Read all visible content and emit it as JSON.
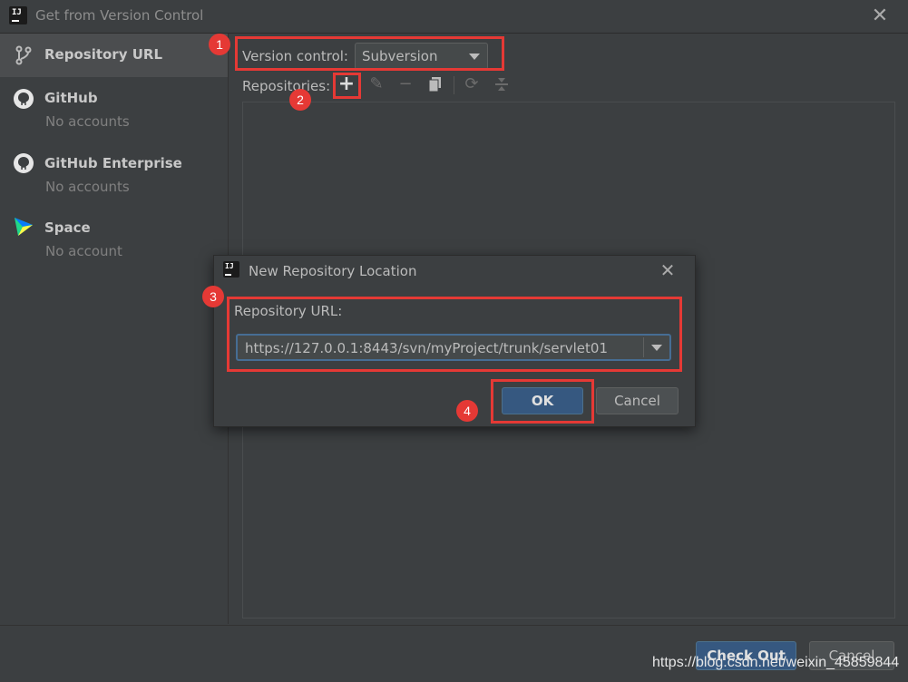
{
  "window": {
    "title": "Get from Version Control"
  },
  "sidebar": {
    "items": [
      {
        "title": "Repository URL",
        "subtitle": "",
        "icon": "branch-icon"
      },
      {
        "title": "GitHub",
        "subtitle": "No accounts",
        "icon": "github-icon"
      },
      {
        "title": "GitHub Enterprise",
        "subtitle": "No accounts",
        "icon": "github-icon"
      },
      {
        "title": "Space",
        "subtitle": "No account",
        "icon": "space-icon"
      }
    ]
  },
  "main": {
    "version_control_label": "Version control:",
    "version_control_value": "Subversion",
    "repositories_label": "Repositories:"
  },
  "footer": {
    "checkout_label": "Check Out",
    "cancel_label": "Cancel"
  },
  "dialog": {
    "title": "New Repository Location",
    "url_label": "Repository URL:",
    "url_value": "https://127.0.0.1:8443/svn/myProject/trunk/servlet01",
    "ok_label": "OK",
    "cancel_label": "Cancel"
  },
  "annotations": [
    "1",
    "2",
    "3",
    "4"
  ],
  "watermark": "https://blog.csdn.net/weixin_45859844",
  "colors": {
    "background": "#3c3f41",
    "primary_button": "#365880",
    "annotation": "#e53935",
    "selection": "#4b4d4f"
  }
}
